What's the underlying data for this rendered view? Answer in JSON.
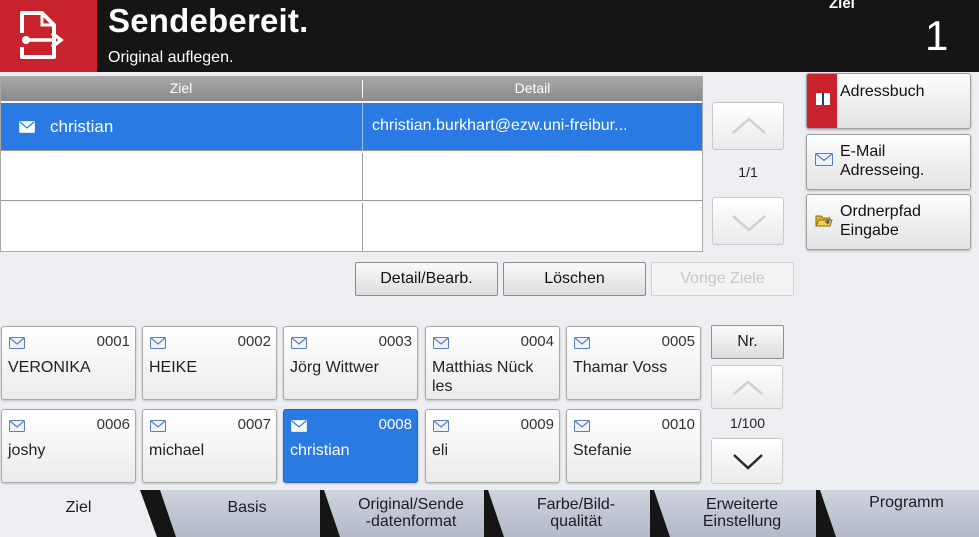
{
  "header": {
    "icon": "send-document-icon",
    "title": "Sendebereit.",
    "subtitle": "Original auflegen.",
    "ziel_label": "Ziel",
    "ziel_count": "1"
  },
  "destinations": {
    "col_ziel": "Ziel",
    "col_detail": "Detail",
    "rows": [
      {
        "icon": "email-icon",
        "name": "christian",
        "detail": "christian.burkhart@ezw.uni-freibur...",
        "selected": true
      },
      {
        "name": "",
        "detail": ""
      },
      {
        "name": "",
        "detail": ""
      }
    ],
    "page": "1/1"
  },
  "side_buttons": {
    "adressbuch": "Adressbuch",
    "email_line1": "E-Mail",
    "email_line2": "Adresseing.",
    "ordner_line1": "Ordnerpfad",
    "ordner_line2": "Eingabe"
  },
  "actions": {
    "detail": "Detail/Bearb.",
    "delete": "Löschen",
    "previous": "Vorige Ziele"
  },
  "address_book": {
    "nr_label": "Nr.",
    "page": "1/100",
    "entries": [
      {
        "num": "0001",
        "name": "VERONIKA"
      },
      {
        "num": "0002",
        "name": "HEIKE"
      },
      {
        "num": "0003",
        "name": "Jörg Wittwer"
      },
      {
        "num": "0004",
        "name": "Matthias Nück les"
      },
      {
        "num": "0005",
        "name": "Thamar Voss"
      },
      {
        "num": "0006",
        "name": "joshy"
      },
      {
        "num": "0007",
        "name": "michael"
      },
      {
        "num": "0008",
        "name": "christian",
        "selected": true
      },
      {
        "num": "0009",
        "name": "eli"
      },
      {
        "num": "0010",
        "name": "Stefanie"
      }
    ]
  },
  "tabs": {
    "ziel": "Ziel",
    "basis": "Basis",
    "original_line1": "Original/Sende",
    "original_line2": "-datenformat",
    "farbe_line1": "Farbe/Bild-",
    "farbe_line2": "qualität",
    "erweitert_line1": "Erweiterte",
    "erweitert_line2": "Einstellung",
    "programm": "Programm"
  },
  "colors": {
    "accent_red": "#c8232c",
    "selection_blue": "#2a7ae3",
    "header_bg": "#151515"
  }
}
